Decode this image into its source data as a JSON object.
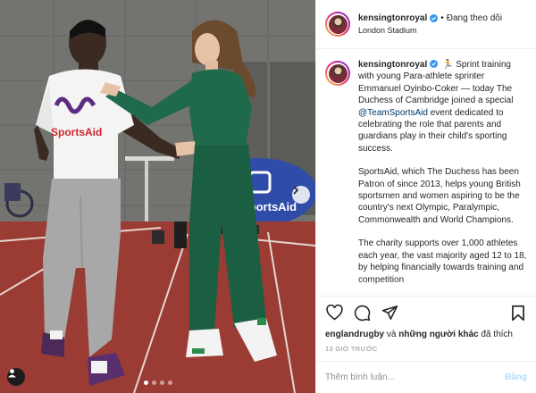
{
  "post": {
    "username": "kensingtonroyal",
    "follow_state": "Đang theo dõi",
    "location": "London Stadium",
    "follow_separator": "•"
  },
  "photo": {
    "banner_brand": "SportsAid",
    "shirt_brand": "SportsAid",
    "slide_count": 4,
    "active_slide": 1
  },
  "caption": {
    "username": "kensingtonroyal",
    "emoji": "🏃",
    "p1_before_mention": "Sprint training with young Para-athlete sprinter Emmanuel Oyinbo-Coker — today The Duchess of Cambridge joined a special",
    "mention": "@TeamSportsAid",
    "p1_after_mention": "event dedicated to celebrating the role that parents and guardians play in their child's sporting success.",
    "p2": "SportsAid, which The Duchess has been Patron of since 2013, helps young British sportsmen and women aspiring to be the country's next Olympic, Paralympic, Commonwealth and World Champions.",
    "p3": "The charity supports over 1,000 athletes each year, the vast majority aged 12 to 18, by helping financially towards training and competition"
  },
  "likes": {
    "first_user": "englandrugby",
    "connector": "và",
    "others": "những người khác",
    "suffix": "đã thích"
  },
  "time": "13 GIỜ TRƯỚC",
  "comment": {
    "placeholder": "Thêm bình luận...",
    "post_label": "Đăng"
  },
  "icons": {
    "like": "heart-icon",
    "comment": "comment-icon",
    "share": "paper-plane-icon",
    "save": "bookmark-icon",
    "verified": "verified-badge-icon",
    "next": "chevron-right-icon",
    "tags": "user-tag-icon"
  },
  "colors": {
    "verified_blue": "#3897f0",
    "mention_blue": "#00376b",
    "post_btn_disabled": "#b2dffc",
    "track_red": "#9a3b34",
    "dress_green": "#1f6a4b",
    "banner_blue": "#2f4da8"
  }
}
